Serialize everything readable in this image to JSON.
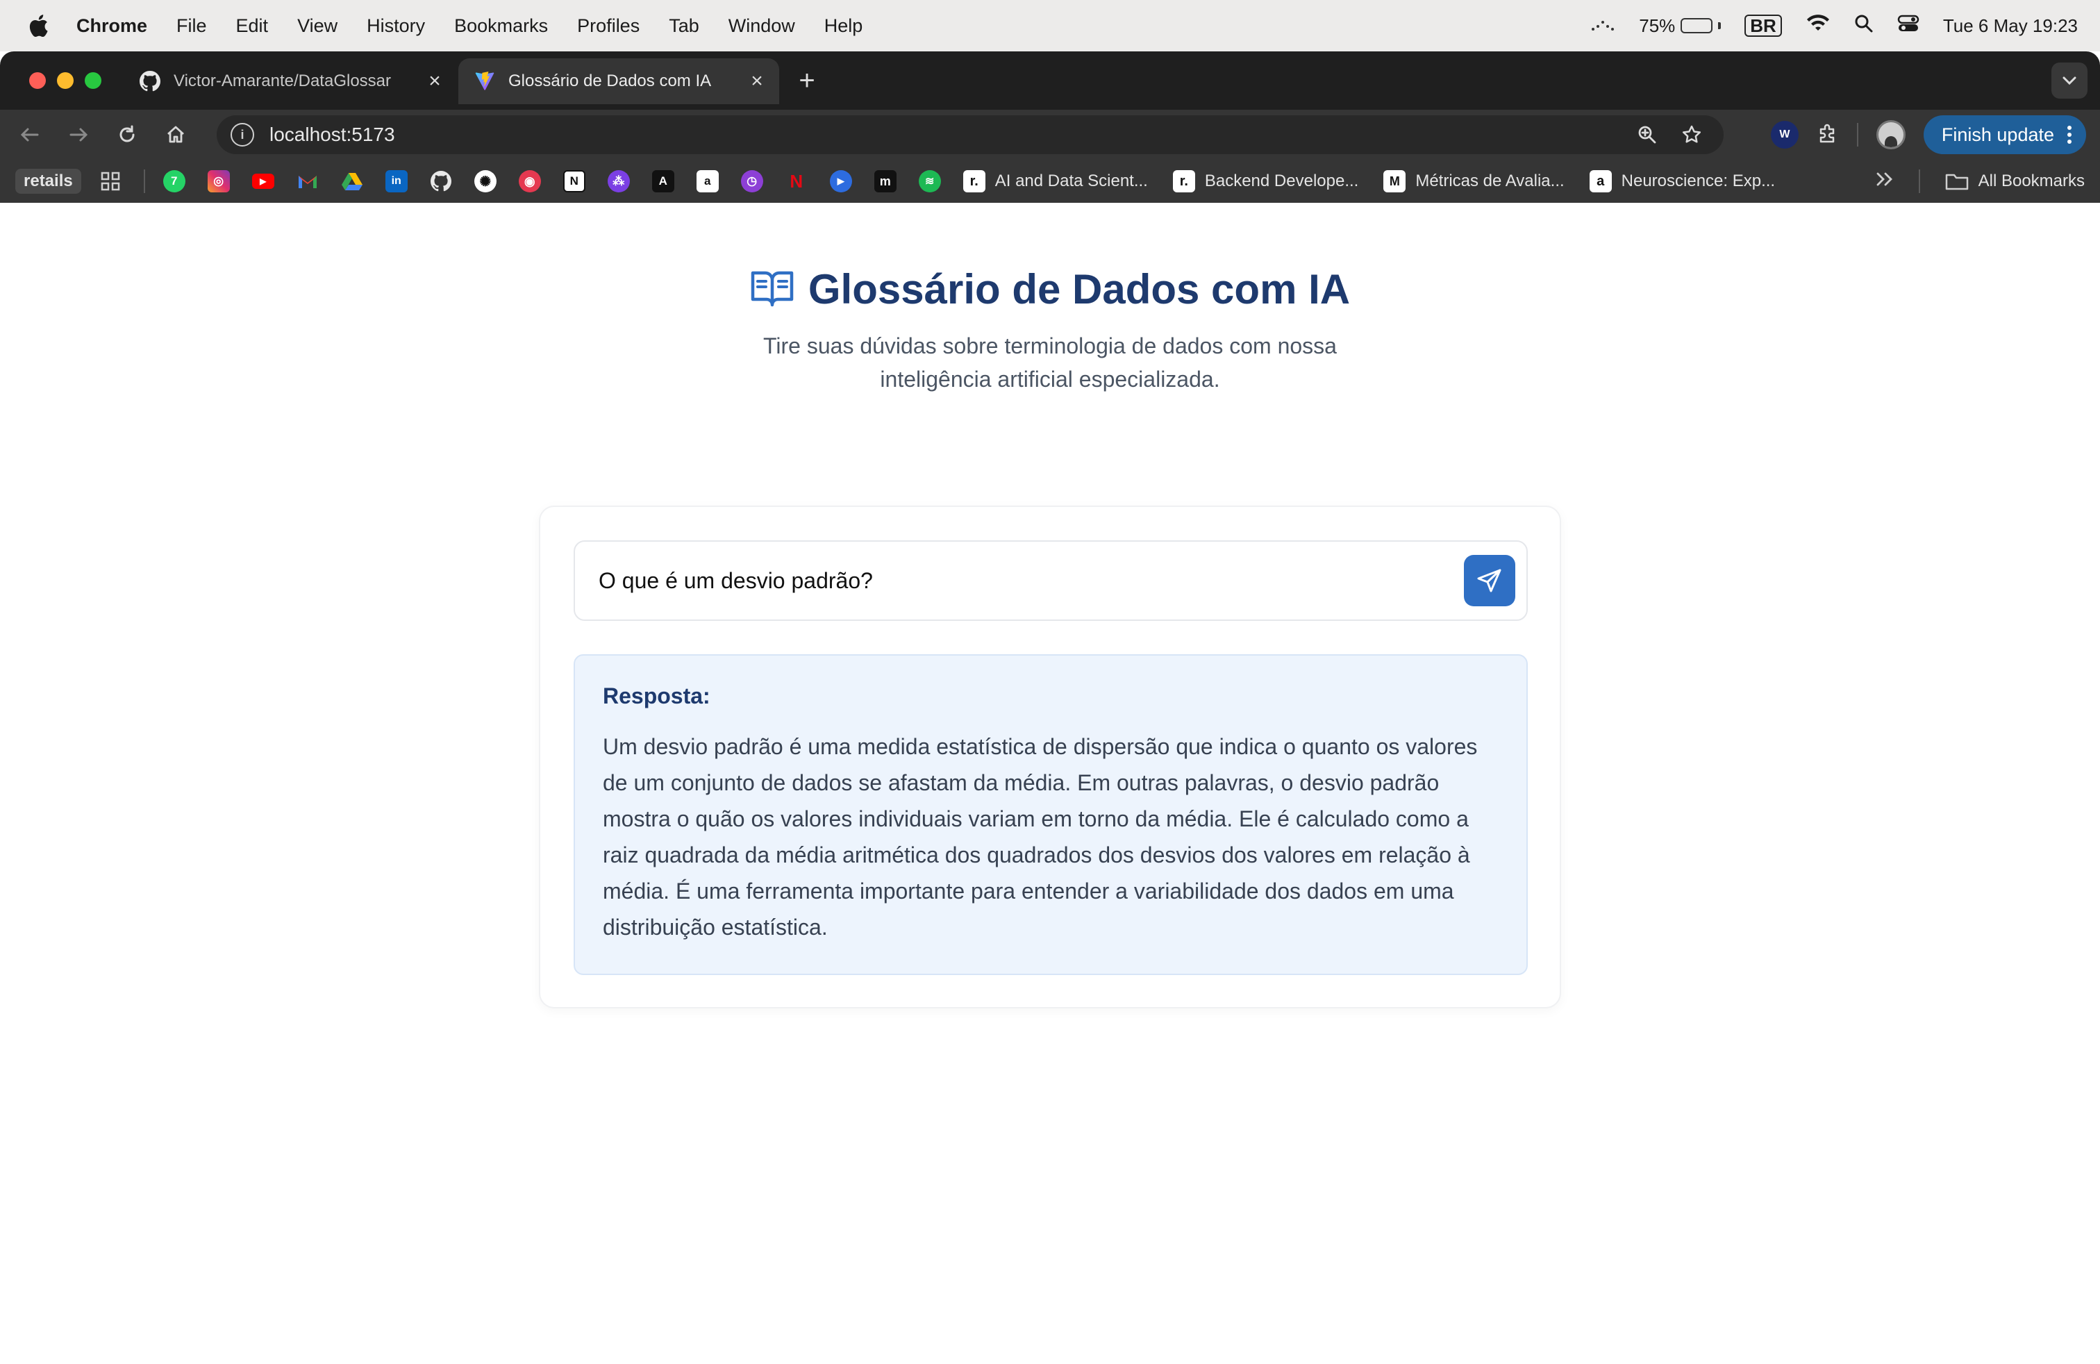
{
  "menubar": {
    "app": "Chrome",
    "items": [
      "File",
      "Edit",
      "View",
      "History",
      "Bookmarks",
      "Profiles",
      "Tab",
      "Window",
      "Help"
    ],
    "battery": "75%",
    "input_source": "BR",
    "datetime": "Tue 6 May  19:23"
  },
  "tabs": [
    {
      "title": "Victor-Amarante/DataGlossar",
      "icon": "github-icon"
    },
    {
      "title": "Glossário de Dados com IA",
      "icon": "vite-icon",
      "active": true
    }
  ],
  "toolbar": {
    "url": "localhost:5173",
    "finish_update": "Finish update"
  },
  "bookmarks": {
    "folder_chip": "retails",
    "icons": [
      "whatsapp",
      "instagram",
      "youtube",
      "gmail",
      "drive",
      "linkedin",
      "github",
      "chatgpt",
      "target",
      "notion",
      "ai-app",
      "notes",
      "amazon",
      "clock",
      "netflix",
      "play",
      "medium",
      "spotify"
    ],
    "labeled": [
      {
        "label": "AI and Data Scient...",
        "icon": "r-icon"
      },
      {
        "label": "Backend Develope...",
        "icon": "r-icon"
      },
      {
        "label": "Métricas de Avalia...",
        "icon": "m-icon"
      },
      {
        "label": "Neuroscience: Exp...",
        "icon": "amazon-icon"
      }
    ],
    "all_bookmarks": "All Bookmarks"
  },
  "page": {
    "title": "Glossário de Dados com IA",
    "subtitle_line1": "Tire suas dúvidas sobre terminologia de dados com nossa",
    "subtitle_line2": "inteligência artificial especializada.",
    "question_value": "O que é um desvio padrão?",
    "answer_label": "Resposta:",
    "answer_text": "Um desvio padrão é uma medida estatística de dispersão que indica o quanto os valores de um conjunto de dados se afastam da média. Em outras palavras, o desvio padrão mostra o quão os valores individuais variam em torno da média. Ele é calculado como a raiz quadrada da média aritmética dos quadrados dos desvios dos valores em relação à média. É uma ferramenta importante para entender a variabilidade dos dados em uma distribuição estatística."
  },
  "colors": {
    "title": "#1e3a6e",
    "accent": "#2f6fc4",
    "answer_bg": "#edf4fd"
  }
}
